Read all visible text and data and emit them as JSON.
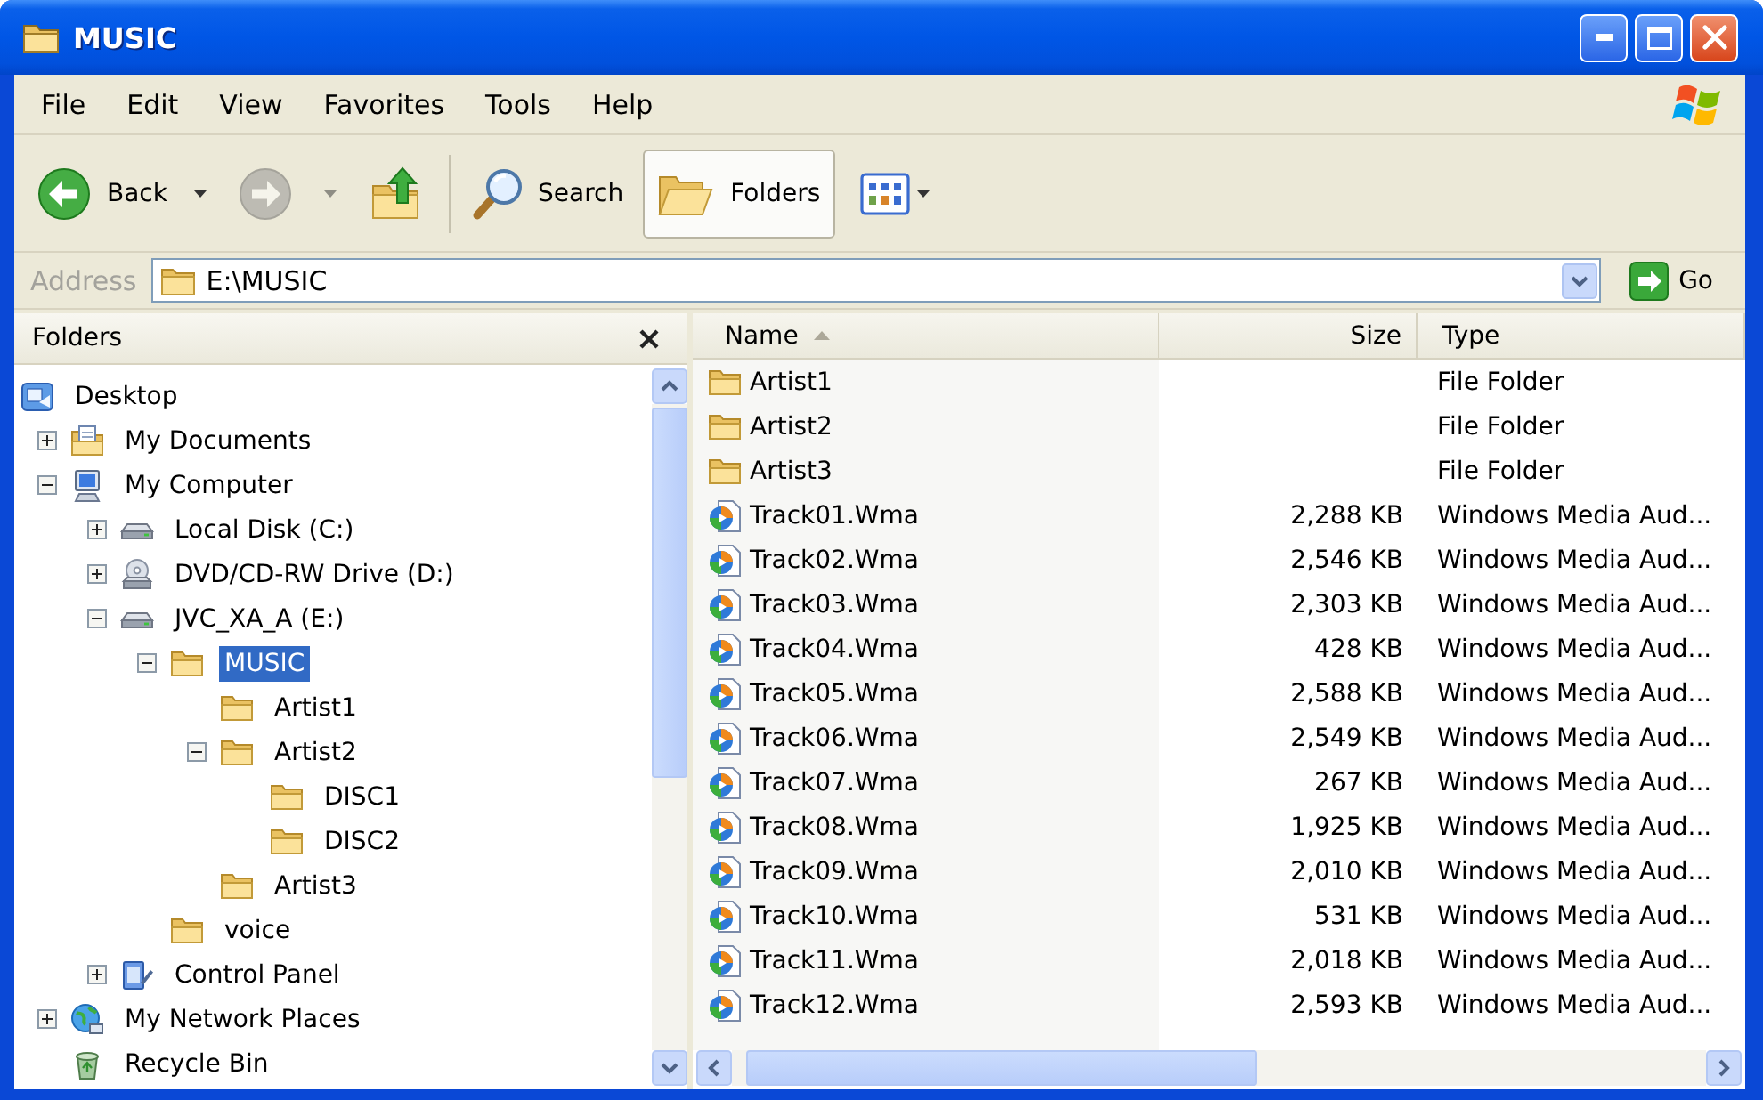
{
  "window": {
    "title": "MUSIC"
  },
  "menu": [
    "File",
    "Edit",
    "View",
    "Favorites",
    "Tools",
    "Help"
  ],
  "toolbar": {
    "navigation": [
      {
        "kind": "back",
        "label": "Back",
        "disabled": false
      },
      {
        "kind": "forward",
        "disabled": true
      },
      {
        "kind": "up",
        "disabled": false
      }
    ],
    "panes": [
      {
        "kind": "search",
        "label": "Search",
        "selected": false
      },
      {
        "kind": "folders",
        "label": "Folders",
        "selected": true
      }
    ]
  },
  "address_bar": {
    "label": "Address",
    "value": "E:\\MUSIC",
    "go_label": "Go"
  },
  "folders_pane": {
    "title": "Folders",
    "tree": [
      {
        "kind": "desktop",
        "label": "Desktop",
        "selected": false,
        "children": [
          {
            "kind": "documents",
            "label": "My Documents",
            "expanded": false,
            "selected": false
          },
          {
            "kind": "computer",
            "label": "My Computer",
            "expanded": true,
            "selected": false,
            "children": [
              {
                "kind": "drive",
                "label": "Local Disk (C:)",
                "expanded": false,
                "selected": false
              },
              {
                "kind": "cdrom",
                "label": "DVD/CD-RW Drive (D:)",
                "expanded": false,
                "selected": false
              },
              {
                "kind": "drive",
                "label": "JVC_XA_A (E:)",
                "expanded": true,
                "selected": false,
                "children": [
                  {
                    "kind": "folder",
                    "label": "MUSIC",
                    "expanded": true,
                    "selected": true,
                    "children": [
                      {
                        "kind": "folder",
                        "label": "Artist1",
                        "selected": false
                      },
                      {
                        "kind": "folder",
                        "label": "Artist2",
                        "expanded": true,
                        "selected": false,
                        "children": [
                          {
                            "kind": "folder",
                            "label": "DISC1",
                            "selected": false
                          },
                          {
                            "kind": "folder",
                            "label": "DISC2",
                            "selected": false
                          }
                        ]
                      },
                      {
                        "kind": "folder",
                        "label": "Artist3",
                        "selected": false
                      }
                    ]
                  },
                  {
                    "kind": "folder",
                    "label": "voice",
                    "selected": false
                  }
                ]
              },
              {
                "kind": "controlpanel",
                "label": "Control Panel",
                "expanded": false,
                "selected": false
              }
            ]
          },
          {
            "kind": "network",
            "label": "My Network Places",
            "expanded": false,
            "selected": false
          },
          {
            "kind": "recyclebin",
            "label": "Recycle Bin",
            "selected": false
          }
        ]
      }
    ]
  },
  "file_list": {
    "columns": [
      {
        "label": "Name",
        "sorted": true
      },
      {
        "label": "Size",
        "sorted": false
      },
      {
        "label": "Type",
        "sorted": false
      }
    ],
    "rows": [
      {
        "kind": "folder",
        "name": "Artist1",
        "type": "File Folder",
        "selected": false
      },
      {
        "kind": "folder",
        "name": "Artist2",
        "type": "File Folder",
        "selected": false
      },
      {
        "kind": "folder",
        "name": "Artist3",
        "type": "File Folder",
        "selected": false
      },
      {
        "kind": "audio",
        "name": "Track01.Wma",
        "size": "2,288 KB",
        "type": "Windows Media Aud...",
        "selected": false
      },
      {
        "kind": "audio",
        "name": "Track02.Wma",
        "size": "2,546 KB",
        "type": "Windows Media Aud...",
        "selected": false
      },
      {
        "kind": "audio",
        "name": "Track03.Wma",
        "size": "2,303 KB",
        "type": "Windows Media Aud...",
        "selected": false
      },
      {
        "kind": "audio",
        "name": "Track04.Wma",
        "size": "428 KB",
        "type": "Windows Media Aud...",
        "selected": false
      },
      {
        "kind": "audio",
        "name": "Track05.Wma",
        "size": "2,588 KB",
        "type": "Windows Media Aud...",
        "selected": false
      },
      {
        "kind": "audio",
        "name": "Track06.Wma",
        "size": "2,549 KB",
        "type": "Windows Media Aud...",
        "selected": false
      },
      {
        "kind": "audio",
        "name": "Track07.Wma",
        "size": "267 KB",
        "type": "Windows Media Aud...",
        "selected": false
      },
      {
        "kind": "audio",
        "name": "Track08.Wma",
        "size": "1,925 KB",
        "type": "Windows Media Aud...",
        "selected": false
      },
      {
        "kind": "audio",
        "name": "Track09.Wma",
        "size": "2,010 KB",
        "type": "Windows Media Aud...",
        "selected": false
      },
      {
        "kind": "audio",
        "name": "Track10.Wma",
        "size": "531 KB",
        "type": "Windows Media Aud...",
        "selected": false
      },
      {
        "kind": "audio",
        "name": "Track11.Wma",
        "size": "2,018 KB",
        "type": "Windows Media Aud...",
        "selected": false
      },
      {
        "kind": "audio",
        "name": "Track12.Wma",
        "size": "2,593 KB",
        "type": "Windows Media Aud...",
        "selected": false
      }
    ]
  }
}
